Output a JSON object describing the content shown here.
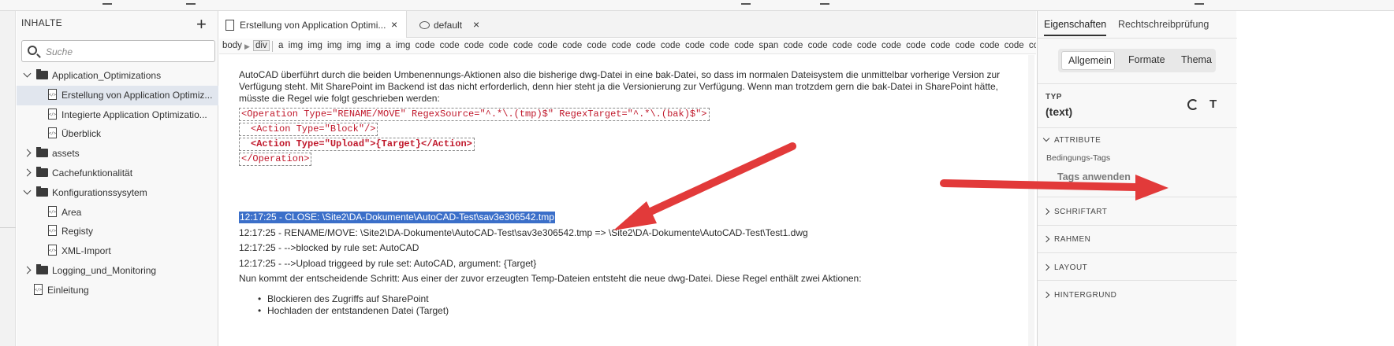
{
  "left_panel": {
    "title": "INHALTE",
    "add": "+",
    "search_placeholder": "Suche",
    "tree": [
      {
        "label": "Application_Optimizations",
        "kind": "folder",
        "expanded": true,
        "depth": 0,
        "selected": false
      },
      {
        "label": "Erstellung von Application Optimiz...",
        "kind": "file",
        "depth": 1,
        "selected": true
      },
      {
        "label": "Integierte Application Optimizatio...",
        "kind": "file",
        "depth": 1,
        "selected": false
      },
      {
        "label": "Überblick",
        "kind": "file",
        "depth": 1,
        "selected": false
      },
      {
        "label": "assets",
        "kind": "folder",
        "expanded": false,
        "depth": 0,
        "selected": false
      },
      {
        "label": "Cachefunktionalität",
        "kind": "folder",
        "expanded": false,
        "depth": 0,
        "selected": false
      },
      {
        "label": "Konfigurationssysytem",
        "kind": "folder",
        "expanded": true,
        "depth": 0,
        "selected": false
      },
      {
        "label": "Area",
        "kind": "file",
        "depth": 1,
        "selected": false
      },
      {
        "label": "Registy",
        "kind": "file",
        "depth": 1,
        "selected": false
      },
      {
        "label": "XML-Import",
        "kind": "file",
        "depth": 1,
        "selected": false
      },
      {
        "label": "Logging_und_Monitoring",
        "kind": "folder",
        "expanded": false,
        "depth": 0,
        "selected": false
      },
      {
        "label": "Einleitung",
        "kind": "file",
        "depth": 0,
        "selected": false
      }
    ]
  },
  "tabs": [
    {
      "label": "Erstellung von Application Optimi...",
      "close": "×"
    },
    {
      "label": "default",
      "close": "×"
    }
  ],
  "breadcrumb": {
    "items": [
      "body",
      "div"
    ],
    "sep": "▶",
    "tags": "a img img img img img a img code code code code code code code code code code code code code code span code code code code code code code code code code code"
  },
  "document": {
    "intro": "AutoCAD überführt durch die beiden Umbenennungs-Aktionen also die bisherige dwg-Datei in eine bak-Datei, so dass im normalen Dateisystem die unmittelbar vorherige Version zur Verfügung steht. Mit SharePoint im Backend ist das nicht erforderlich, denn hier steht ja die Versionierung zur Verfügung. Wenn man trotzdem gern die bak-Datei in SharePoint hätte, müsste die Regel wie folgt geschrieben werden:",
    "code": [
      "<Operation Type=\"RENAME/MOVE\" RegexSource=\"^.*\\.(tmp)$\" RegexTarget=\"^.*\\.(bak)$\">",
      "<Action Type=\"Block\"/>",
      "<Action Type=\"Upload\">{Target}</Action>",
      "</Operation>"
    ],
    "log": [
      "12:17:25 - CLOSE: \\Site2\\DA-Dokumente\\AutoCAD-Test\\sav3e306542.tmp",
      "12:17:25 - RENAME/MOVE: \\Site2\\DA-Dokumente\\AutoCAD-Test\\sav3e306542.tmp => \\Site2\\DA-Dokumente\\AutoCAD-Test\\Test1.dwg",
      "12:17:25 - -->blocked by rule set: AutoCAD",
      "12:17:25 - -->Upload triggeed by rule set: AutoCAD, argument: {Target}"
    ],
    "next": "Nun kommt der entscheidende Schritt: Aus einer der zuvor erzeugten Temp-Dateien entsteht die neue dwg-Datei. Diese Regel enthält zwei Aktionen:",
    "bullets": [
      "Blockieren des Zugriffs auf SharePoint",
      "Hochladen der entstandenen Datei (Target)"
    ]
  },
  "right_panel": {
    "tabs": [
      "Eigenschaften",
      "Rechtschreibprüfung"
    ],
    "segments": [
      "Allgemein",
      "Formate",
      "Thema"
    ],
    "type_label": "TYP",
    "type_value": "(text)",
    "attribute_label": "ATTRIBUTE",
    "conditional_tags_label": "Bedingungs-Tags",
    "apply_tags": "Tags anwenden",
    "sections": [
      "SCHRIFTART",
      "RAHMEN",
      "LAYOUT",
      "HINTERGRUND"
    ]
  },
  "colors": {
    "selection": "#3b6fc9",
    "code_text": "#c0182b",
    "arrow": "#e23a3a",
    "tree_selected": "#e1e6ee"
  }
}
